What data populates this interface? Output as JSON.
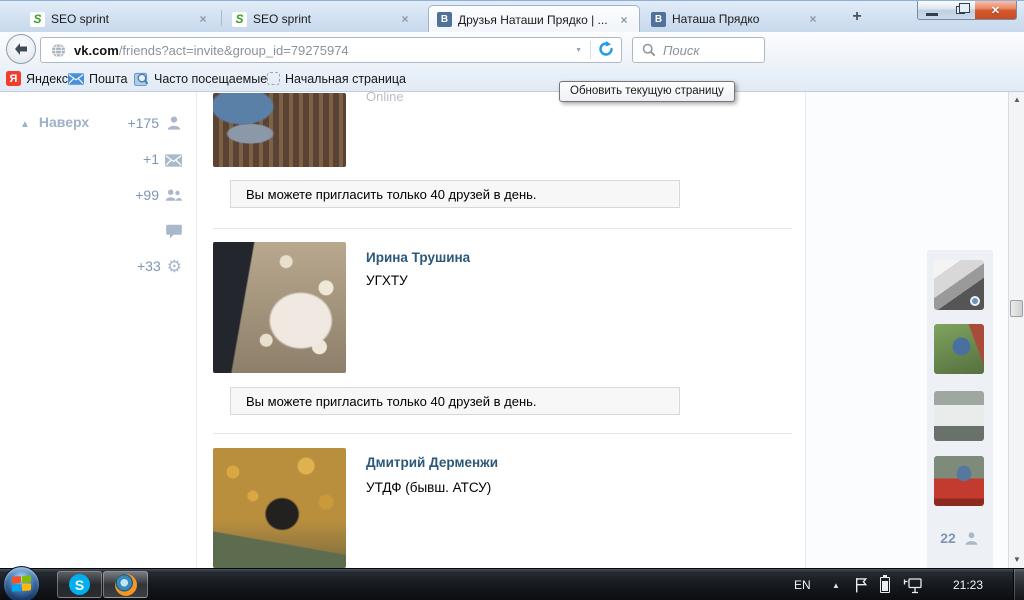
{
  "tabs": {
    "items": [
      {
        "title": "SEO sprint"
      },
      {
        "title": "SEO sprint"
      },
      {
        "title": "Друзья Наташи Прядко | ..."
      },
      {
        "title": "Наташа Прядко"
      }
    ],
    "favicons": {
      "seo": "S",
      "vk": "В"
    }
  },
  "glyphs": {
    "close_tab": "×",
    "new_tab": "+",
    "window_close": "✕",
    "url_caret": "▼",
    "to_top_arrow": "▲",
    "gear": "⚙",
    "scroll_up": "▲",
    "scroll_down": "▼",
    "tray_expand": "▲"
  },
  "nav": {
    "url_domain": "vk.com",
    "url_path": "/friends?act=invite&group_id=79275974",
    "search_placeholder": "Поиск",
    "tooltip": "Обновить текущую страницу"
  },
  "bookmarks": {
    "items": [
      {
        "label": "Яндекс",
        "letter": "Я"
      },
      {
        "label": "Пошта"
      },
      {
        "label": "Часто посещаемые"
      },
      {
        "label": "Начальная страница"
      }
    ]
  },
  "page": {
    "left_nav": {
      "to_top": "Наверх",
      "counters": [
        {
          "icon": "friends",
          "count": "+175"
        },
        {
          "icon": "messages",
          "count": "+1"
        },
        {
          "icon": "groups",
          "count": "+99"
        },
        {
          "icon": "comments",
          "count": ""
        },
        {
          "icon": "settings",
          "count": "+33"
        }
      ]
    },
    "friends": [
      {
        "status": "Online"
      },
      {
        "name": "Ирина Трушина",
        "detail": "УГХТУ"
      },
      {
        "name": "Дмитрий Дерменжи",
        "detail": "УТДФ (бывш. АТСУ)"
      }
    ],
    "limit_message": "Вы можете пригласить только 40 друзей в день.",
    "invited_count": "22"
  },
  "taskbar": {
    "skype_letter": "S",
    "language": "EN",
    "time": "21:23"
  },
  "colors": {
    "vk_link": "#2b587a",
    "vk_muted": "#a9b8ca",
    "reload_blue": "#1f9cea",
    "close_red": "#d55a2e"
  }
}
